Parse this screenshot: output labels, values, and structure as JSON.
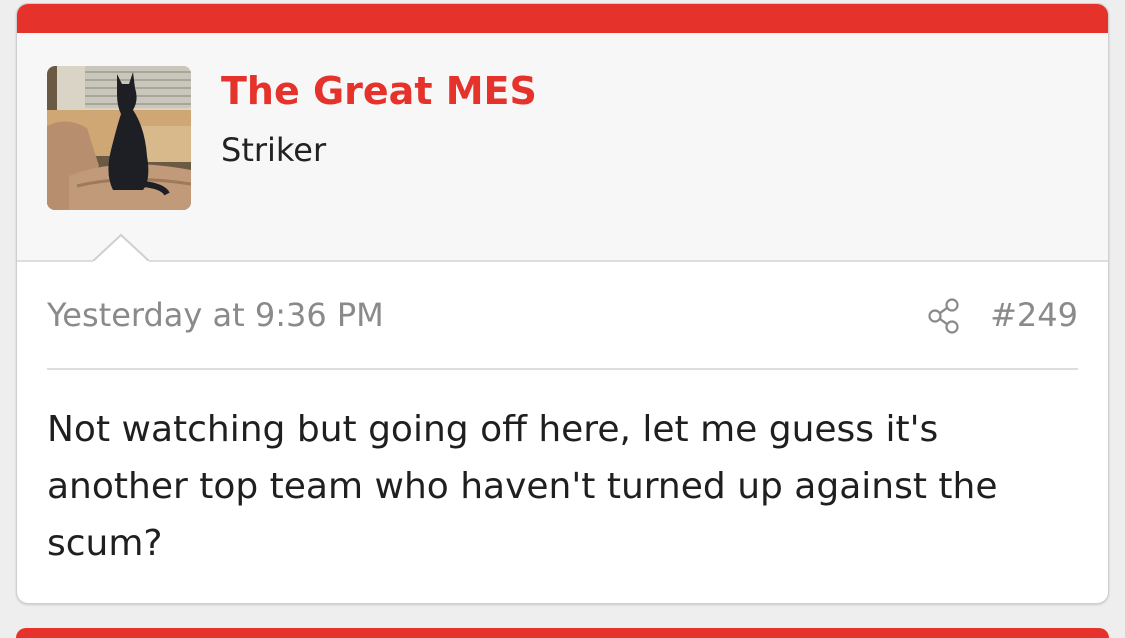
{
  "post": {
    "username": "The Great MES",
    "user_title": "Striker",
    "timestamp": "Yesterday at 9:36 PM",
    "post_number": "#249",
    "message": "Not watching but going off here, let me guess it's another top team who haven't turned up against the scum?"
  },
  "icons": {
    "share": "share-icon",
    "avatar": "cat-at-window-photo"
  },
  "colors": {
    "accent": "#e5322b",
    "meta_text": "#8a8a8a",
    "body_text": "#1f1f1f"
  }
}
